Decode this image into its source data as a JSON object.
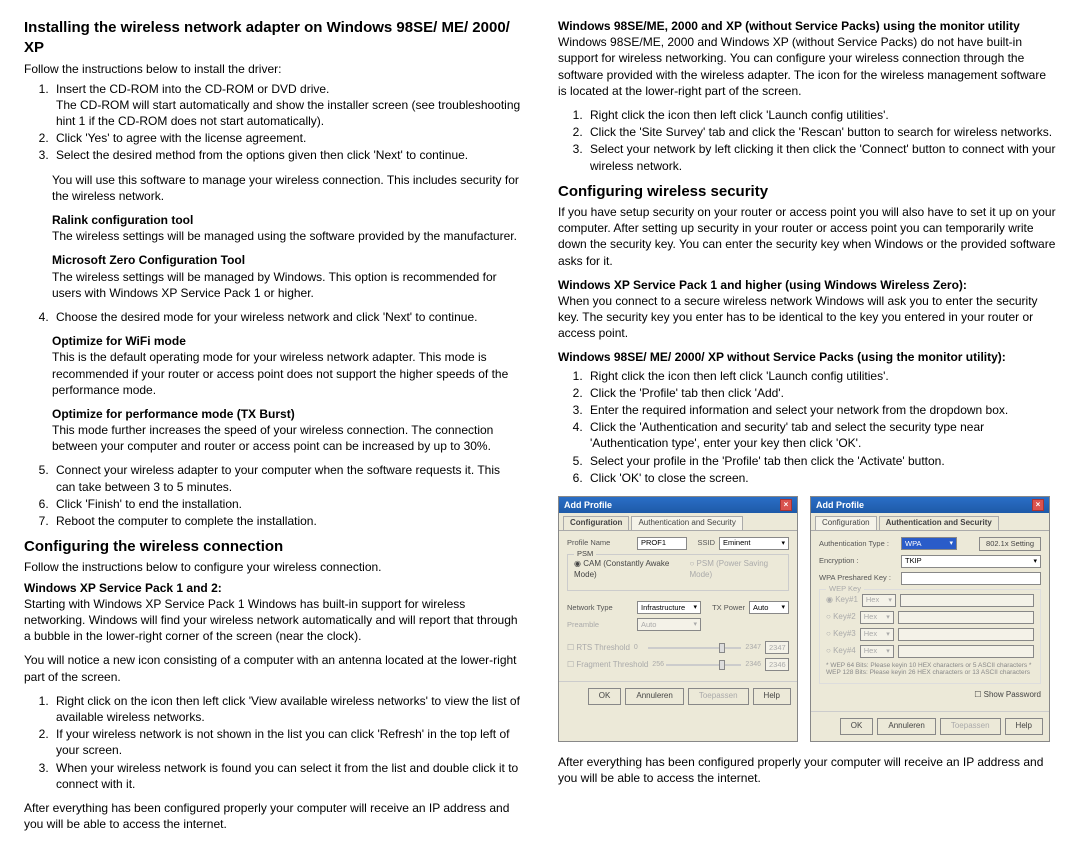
{
  "left": {
    "h_install": "Installing the wireless network adapter on Windows 98SE/ ME/ 2000/ XP",
    "follow": "Follow the instructions below to install the driver:",
    "li1": "Insert the CD-ROM into the CD-ROM or DVD drive.",
    "li1b": "The CD-ROM will start automatically and show the installer screen (see troubleshooting hint 1 if the CD-ROM does not start automatically).",
    "li2": "Click 'Yes' to agree with the license agreement.",
    "li3": "Select the desired method from the options given then click 'Next' to continue.",
    "note_use": "You will use this software to manage your wireless connection. This includes security for the wireless network.",
    "ralink_h": "Ralink configuration tool",
    "ralink_p": "The wireless settings will be managed using the software provided by the manufacturer.",
    "zero_h": "Microsoft Zero Configuration Tool",
    "zero_p": "The wireless settings will be managed by Windows. This option is recommended for users with Windows XP Service Pack 1 or higher.",
    "li4": "Choose the desired mode for your wireless network and click 'Next' to continue.",
    "opt_wifi_h": "Optimize for WiFi mode",
    "opt_wifi_p": "This is the default operating mode for your wireless network adapter. This mode is recommended if your router or access point does not support the higher speeds of the performance mode.",
    "opt_tx_h": "Optimize for performance mode (TX Burst)",
    "opt_tx_p": "This mode further increases the speed of your wireless connection. The connection between your computer and router or access point can be increased by up to 30%.",
    "li5": "Connect your wireless adapter to your computer when the software requests it. This can take between 3 to 5 minutes.",
    "li6": "Click 'Finish' to end the installation.",
    "li7": "Reboot the computer to complete the installation.",
    "h_config": "Configuring the wireless connection",
    "config_follow": "Follow the instructions below to configure your wireless connection.",
    "xp12_h": "Windows XP Service Pack 1 and 2:",
    "xp12_p": "Starting with Windows XP Service Pack 1 Windows has built-in support for wireless networking. Windows will find your wireless network automatically and will report that through a bubble in the lower-right corner of the screen (near the clock).",
    "notice_icon": "You will notice a new icon consisting of a computer with an antenna located at the lower-right part of the screen.",
    "c_li1": "Right click on the icon then left click 'View available wireless networks' to view the list of available wireless networks.",
    "c_li2": "If your wireless network is not shown in the list you can click 'Refresh' in the top left of your screen.",
    "c_li3": "When your wireless network is found you can select it from the list and double click it to connect with it.",
    "after": "After everything has been configured properly your computer will receive an IP address and you will be able to access the internet."
  },
  "right": {
    "mon_h": "Windows 98SE/ME, 2000 and XP (without Service Packs) using the monitor utility",
    "mon_p": "Windows 98SE/ME, 2000 and Windows XP (without Service Packs) do not have built-in support for wireless networking. You can configure your wireless connection through the software provided with the wireless adapter. The icon for the wireless management software is located at the lower-right part of the screen.",
    "r_li1": "Right click the icon then left click 'Launch config utilities'.",
    "r_li2": "Click the 'Site Survey' tab and click the 'Rescan' button to search for wireless networks.",
    "r_li3": "Select your network by left clicking it then click the 'Connect' button to connect with your wireless network.",
    "h_sec": "Configuring wireless security",
    "sec_p": "If you have setup security on your router or access point you will also have to set it up on your computer. After setting up security in your router or access point you can temporarily write down the security key. You can enter the security key when Windows or the provided software asks for it.",
    "xpz_h": "Windows XP Service Pack 1 and higher (using Windows Wireless Zero):",
    "xpz_p": "When you connect to a secure wireless network Windows will ask you to enter the security key. The security key you enter has to be identical to the key you entered in your router or access point.",
    "nosp_h": "Windows 98SE/ ME/ 2000/ XP without Service Packs (using the monitor utility):",
    "s_li1": "Right click the icon then left click 'Launch config utilities'.",
    "s_li2": "Click the 'Profile' tab then click 'Add'.",
    "s_li3": "Enter the required information and select your network from the dropdown box.",
    "s_li4": "Click the 'Authentication and security' tab and select the security type near 'Authentication type', enter your key then click 'OK'.",
    "s_li5": "Select your profile in the 'Profile' tab then click the 'Activate' button.",
    "s_li6": "Click 'OK' to close the screen.",
    "after2": "After everything has been configured properly your computer will receive an IP address and you will be able to access the internet."
  },
  "dlg": {
    "title": "Add Profile",
    "tab_config": "Configuration",
    "tab_auth": "Authentication and Security",
    "profile_name_lbl": "Profile Name",
    "profile_name_val": "PROF1",
    "ssid_lbl": "SSID",
    "ssid_val": "Eminent",
    "psm_legend": "PSM",
    "cam": "CAM (Constantly Awake Mode)",
    "psm": "PSM (Power Saving Mode)",
    "net_type_lbl": "Network Type",
    "net_type_val": "Infrastructure",
    "tx_lbl": "TX Power",
    "tx_val": "Auto",
    "preamble_lbl": "Preamble",
    "preamble_val": "Auto",
    "rts_chk": "RTS Threshold",
    "rts_val": "2347",
    "frag_chk": "Fragment Threshold",
    "frag_min": "256",
    "frag_val": "2346",
    "btn_ok": "OK",
    "btn_cancel": "Annuleren",
    "btn_apply": "Toepassen",
    "btn_help": "Help",
    "auth_type_lbl": "Authentication Type :",
    "auth_type_val": "WPA",
    "auth_8021x": "802.1x Setting",
    "enc_lbl": "Encryption :",
    "enc_val": "TKIP",
    "wpa_key_lbl": "WPA Preshared Key :",
    "wep_legend": "WEP Key",
    "key1": "Key#1",
    "key2": "Key#2",
    "key3": "Key#3",
    "key4": "Key#4",
    "hex": "Hex",
    "note": "* WEP 64 Bits: Please keyin 10 HEX characters or 5 ASCII characters\n* WEP 128 Bits: Please keyin 26 HEX characters or 13 ASCII characters",
    "show_pw": "Show Password"
  }
}
